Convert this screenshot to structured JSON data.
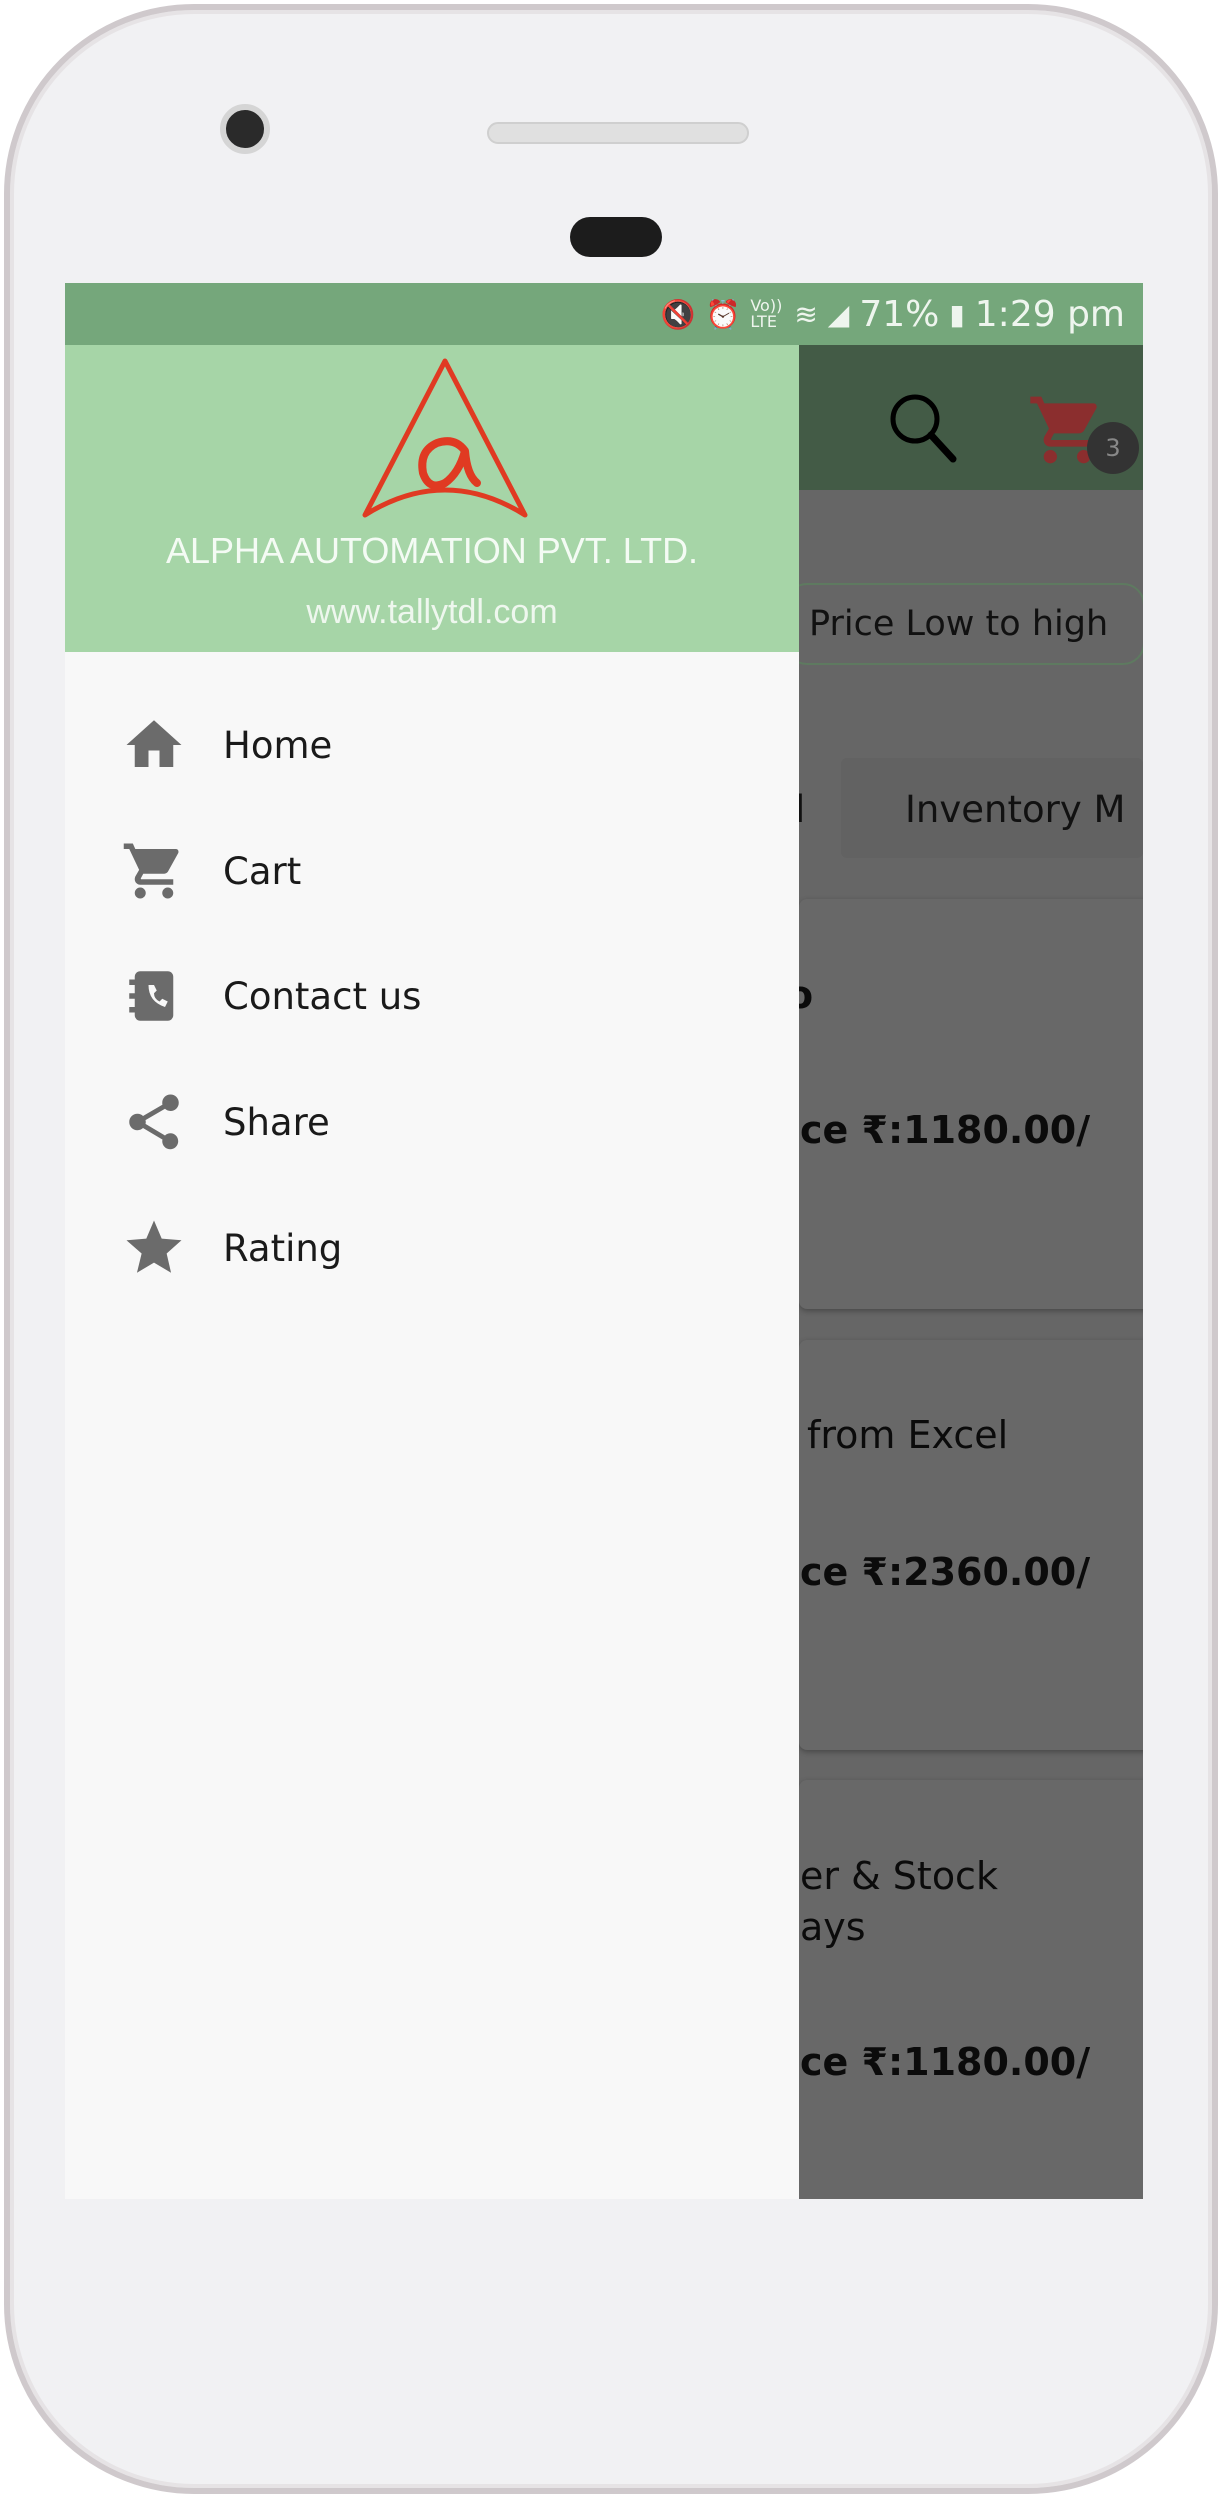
{
  "status_bar": {
    "icons": [
      "mute-vibrate-icon",
      "alarm-icon",
      "volte-icon",
      "wifi-icon",
      "signal-icon"
    ],
    "volte": "Vo)) LTE",
    "battery": "71%",
    "time": "1:29 pm"
  },
  "toolbar": {
    "cart_count": "3",
    "cart_color": "#8b2e2e"
  },
  "sort_chip": "Price Low  to high",
  "category_tabs": [
    "l",
    "Inventory M"
  ],
  "products": [
    {
      "title": [
        "o"
      ],
      "price": "ce ₹:1180.00/"
    },
    {
      "title": [
        "from Excel"
      ],
      "price": "ce ₹:2360.00/"
    },
    {
      "title": [
        "er & Stock",
        "ays"
      ],
      "price": "ce ₹:1180.00/"
    }
  ],
  "drawer": {
    "company": "ALPHA AUTOMATION PVT. LTD.",
    "website": "www.tallytdl.com",
    "header_color": "#a6d5a7",
    "logo_color": "#e03a22",
    "items": [
      {
        "label": "Home",
        "icon": "home-icon"
      },
      {
        "label": "Cart",
        "icon": "cart-icon"
      },
      {
        "label": "Contact us",
        "icon": "contact-book-icon"
      },
      {
        "label": "Share",
        "icon": "share-icon"
      },
      {
        "label": "Rating",
        "icon": "star-icon"
      }
    ]
  }
}
